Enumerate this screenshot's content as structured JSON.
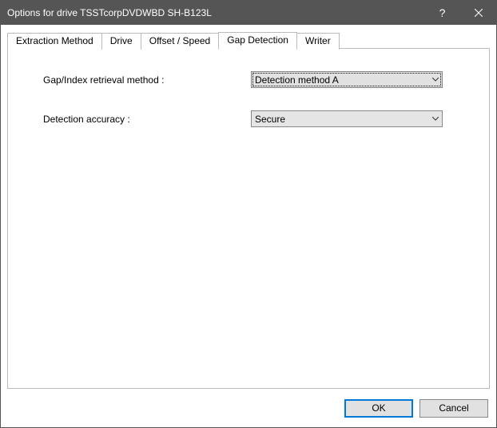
{
  "window": {
    "title": "Options for drive TSSTcorpDVDWBD SH-B123L"
  },
  "tabs": [
    {
      "label": "Extraction Method"
    },
    {
      "label": "Drive"
    },
    {
      "label": "Offset / Speed"
    },
    {
      "label": "Gap Detection"
    },
    {
      "label": "Writer"
    }
  ],
  "active_tab_index": 3,
  "gap_detection": {
    "retrieval_label": "Gap/Index retrieval method :",
    "retrieval_value": "Detection method A",
    "accuracy_label": "Detection accuracy :",
    "accuracy_value": "Secure"
  },
  "buttons": {
    "ok": "OK",
    "cancel": "Cancel"
  }
}
